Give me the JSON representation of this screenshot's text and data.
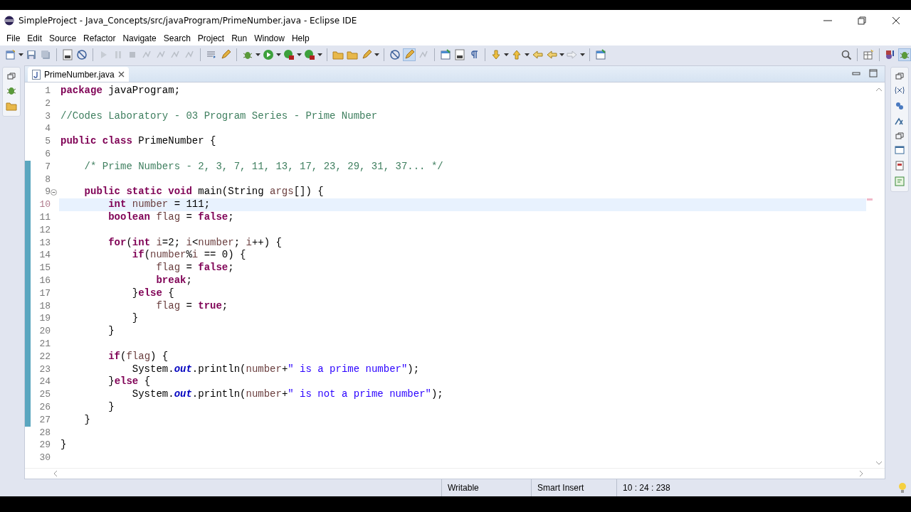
{
  "window": {
    "title": "SimpleProject - Java_Concepts/src/javaProgram/PrimeNumber.java - Eclipse IDE"
  },
  "menu": [
    "File",
    "Edit",
    "Source",
    "Refactor",
    "Navigate",
    "Search",
    "Project",
    "Run",
    "Window",
    "Help"
  ],
  "editor_tabs": [
    {
      "label": "PrimeNumber.java",
      "selected": true
    }
  ],
  "lines": [
    {
      "number": "1",
      "changed": false,
      "current": false,
      "fold": false,
      "tokens": [
        {
          "kind": "kw",
          "text": "package"
        },
        {
          "kind": "plain",
          "text": " javaProgram;"
        }
      ]
    },
    {
      "number": "2",
      "changed": false,
      "current": false,
      "fold": false
    },
    {
      "number": "3",
      "changed": false,
      "current": false,
      "fold": false,
      "tokens": [
        {
          "kind": "comment",
          "text": "//Codes Laboratory - 03 Program Series - Prime Number"
        }
      ]
    },
    {
      "number": "4",
      "changed": false,
      "current": false,
      "fold": false
    },
    {
      "number": "5",
      "changed": false,
      "current": false,
      "fold": false,
      "tokens": [
        {
          "kind": "kw",
          "text": "public class"
        },
        {
          "kind": "plain",
          "text": " PrimeNumber {"
        }
      ]
    },
    {
      "number": "6",
      "changed": false,
      "current": false,
      "fold": false
    },
    {
      "number": "7",
      "changed": true,
      "current": false,
      "fold": false,
      "tokens": [
        {
          "kind": "comment",
          "text": "    /* Prime Numbers - 2, 3, 7, 11, 13, 17, 23, 29, 31, 37... */"
        }
      ]
    },
    {
      "number": "8",
      "changed": true,
      "current": false,
      "fold": false
    },
    {
      "number": "9",
      "changed": true,
      "current": false,
      "fold": true,
      "tokens": [
        {
          "kind": "kw",
          "text": "    public static void"
        },
        {
          "kind": "plain",
          "text": " main(String "
        },
        {
          "kind": "local",
          "text": "args"
        },
        {
          "kind": "plain",
          "text": "[]) {"
        }
      ]
    },
    {
      "number": "10",
      "changed": true,
      "current": true,
      "fold": false,
      "tokens": [
        {
          "kind": "kw",
          "text": "        int"
        },
        {
          "kind": "local",
          "text": " number"
        },
        {
          "kind": "plain",
          "text": " = 111;"
        }
      ]
    },
    {
      "number": "11",
      "changed": true,
      "current": false,
      "fold": false,
      "tokens": [
        {
          "kind": "kw",
          "text": "        boolean"
        },
        {
          "kind": "local",
          "text": " flag"
        },
        {
          "kind": "plain",
          "text": " = "
        },
        {
          "kind": "kw",
          "text": "false"
        },
        {
          "kind": "plain",
          "text": ";"
        }
      ]
    },
    {
      "number": "12",
      "changed": true,
      "current": false,
      "fold": false
    },
    {
      "number": "13",
      "changed": true,
      "current": false,
      "fold": false,
      "tokens": [
        {
          "kind": "kw",
          "text": "        for"
        },
        {
          "kind": "plain",
          "text": "("
        },
        {
          "kind": "kw",
          "text": "int"
        },
        {
          "kind": "local",
          "text": " i"
        },
        {
          "kind": "plain",
          "text": "=2; "
        },
        {
          "kind": "local",
          "text": "i"
        },
        {
          "kind": "plain",
          "text": "<"
        },
        {
          "kind": "local",
          "text": "number"
        },
        {
          "kind": "plain",
          "text": "; "
        },
        {
          "kind": "local",
          "text": "i"
        },
        {
          "kind": "plain",
          "text": "++) {"
        }
      ]
    },
    {
      "number": "14",
      "changed": true,
      "current": false,
      "fold": false,
      "tokens": [
        {
          "kind": "kw",
          "text": "            if"
        },
        {
          "kind": "plain",
          "text": "("
        },
        {
          "kind": "local",
          "text": "number"
        },
        {
          "kind": "plain",
          "text": "%"
        },
        {
          "kind": "local",
          "text": "i"
        },
        {
          "kind": "plain",
          "text": " == 0) {"
        }
      ]
    },
    {
      "number": "15",
      "changed": true,
      "current": false,
      "fold": false,
      "tokens": [
        {
          "kind": "local",
          "text": "                flag"
        },
        {
          "kind": "plain",
          "text": " = "
        },
        {
          "kind": "kw",
          "text": "false"
        },
        {
          "kind": "plain",
          "text": ";"
        }
      ]
    },
    {
      "number": "16",
      "changed": true,
      "current": false,
      "fold": false,
      "tokens": [
        {
          "kind": "kw",
          "text": "                break"
        },
        {
          "kind": "plain",
          "text": ";"
        }
      ]
    },
    {
      "number": "17",
      "changed": true,
      "current": false,
      "fold": false,
      "tokens": [
        {
          "kind": "plain",
          "text": "            }"
        },
        {
          "kind": "kw",
          "text": "else"
        },
        {
          "kind": "plain",
          "text": " {"
        }
      ]
    },
    {
      "number": "18",
      "changed": true,
      "current": false,
      "fold": false,
      "tokens": [
        {
          "kind": "local",
          "text": "                flag"
        },
        {
          "kind": "plain",
          "text": " = "
        },
        {
          "kind": "kw",
          "text": "true"
        },
        {
          "kind": "plain",
          "text": ";"
        }
      ]
    },
    {
      "number": "19",
      "changed": true,
      "current": false,
      "fold": false,
      "tokens": [
        {
          "kind": "plain",
          "text": "            }"
        }
      ]
    },
    {
      "number": "20",
      "changed": true,
      "current": false,
      "fold": false,
      "tokens": [
        {
          "kind": "plain",
          "text": "        }"
        }
      ]
    },
    {
      "number": "21",
      "changed": true,
      "current": false,
      "fold": false
    },
    {
      "number": "22",
      "changed": true,
      "current": false,
      "fold": false,
      "tokens": [
        {
          "kind": "kw",
          "text": "        if"
        },
        {
          "kind": "plain",
          "text": "("
        },
        {
          "kind": "local",
          "text": "flag"
        },
        {
          "kind": "plain",
          "text": ") {"
        }
      ]
    },
    {
      "number": "23",
      "changed": true,
      "current": false,
      "fold": false,
      "tokens": [
        {
          "kind": "plain",
          "text": "            System."
        },
        {
          "kind": "field",
          "text": "out"
        },
        {
          "kind": "plain",
          "text": ".println("
        },
        {
          "kind": "local",
          "text": "number"
        },
        {
          "kind": "plain",
          "text": "+"
        },
        {
          "kind": "string",
          "text": "\" is a prime number\""
        },
        {
          "kind": "plain",
          "text": ");"
        }
      ]
    },
    {
      "number": "24",
      "changed": true,
      "current": false,
      "fold": false,
      "tokens": [
        {
          "kind": "plain",
          "text": "        }"
        },
        {
          "kind": "kw",
          "text": "else"
        },
        {
          "kind": "plain",
          "text": " {"
        }
      ]
    },
    {
      "number": "25",
      "changed": true,
      "current": false,
      "fold": false,
      "tokens": [
        {
          "kind": "plain",
          "text": "            System."
        },
        {
          "kind": "field",
          "text": "out"
        },
        {
          "kind": "plain",
          "text": ".println("
        },
        {
          "kind": "local",
          "text": "number"
        },
        {
          "kind": "plain",
          "text": "+"
        },
        {
          "kind": "string",
          "text": "\" is not a prime number\""
        },
        {
          "kind": "plain",
          "text": ");"
        }
      ]
    },
    {
      "number": "26",
      "changed": true,
      "current": false,
      "fold": false,
      "tokens": [
        {
          "kind": "plain",
          "text": "        }"
        }
      ]
    },
    {
      "number": "27",
      "changed": true,
      "current": false,
      "fold": false,
      "tokens": [
        {
          "kind": "plain",
          "text": "    }"
        }
      ]
    },
    {
      "number": "28",
      "changed": false,
      "current": false,
      "fold": false
    },
    {
      "number": "29",
      "changed": false,
      "current": false,
      "fold": false,
      "tokens": [
        {
          "kind": "plain",
          "text": "}"
        }
      ]
    },
    {
      "number": "30",
      "changed": false,
      "current": false,
      "fold": false
    }
  ],
  "status_bar": {
    "mode": "Writable",
    "insert": "Smart Insert",
    "position": "10 : 24 : 238"
  }
}
